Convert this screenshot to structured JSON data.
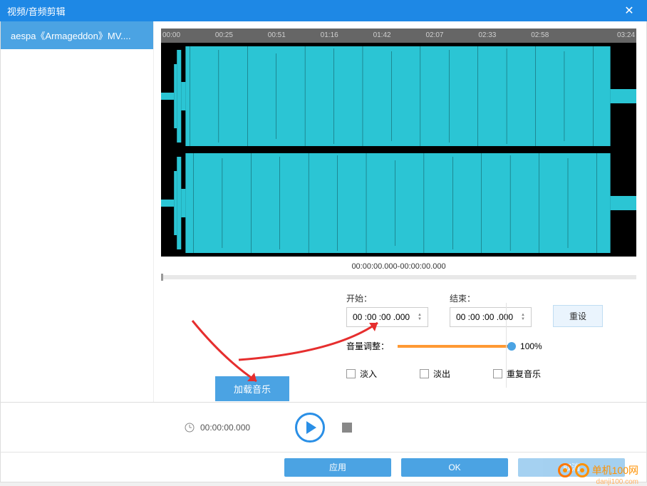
{
  "window": {
    "title": "视频/音频剪辑"
  },
  "sidebar": {
    "file": "aespa《Armageddon》MV...."
  },
  "timeline": {
    "ticks": [
      "00:00",
      "00:25",
      "00:51",
      "01:16",
      "01:42",
      "02:07",
      "02:33",
      "02:58",
      "03:24"
    ],
    "range": "00:00:00.000-00:00:00.000"
  },
  "controls": {
    "start_label": "开始：",
    "end_label": "结束：",
    "start_val": "00 :00 :00 .000",
    "end_val": "00 :00 :00 .000",
    "reset": "重设",
    "volume_label": "音量调整：",
    "volume_pct": "100%",
    "fade_in": "淡入",
    "fade_out": "淡出",
    "repeat": "重复音乐",
    "load_music": "加载音乐"
  },
  "playback": {
    "clock": "00:00:00.000"
  },
  "actions": {
    "apply": "应用",
    "ok": "OK",
    "cancel": "取消"
  },
  "watermark": {
    "name": "单机100网",
    "url": "danji100.com"
  },
  "colors": {
    "accent": "#4ba3e3",
    "wave": "#2bc5d4",
    "arrow": "#e62e2e",
    "orange": "#ff9933"
  }
}
